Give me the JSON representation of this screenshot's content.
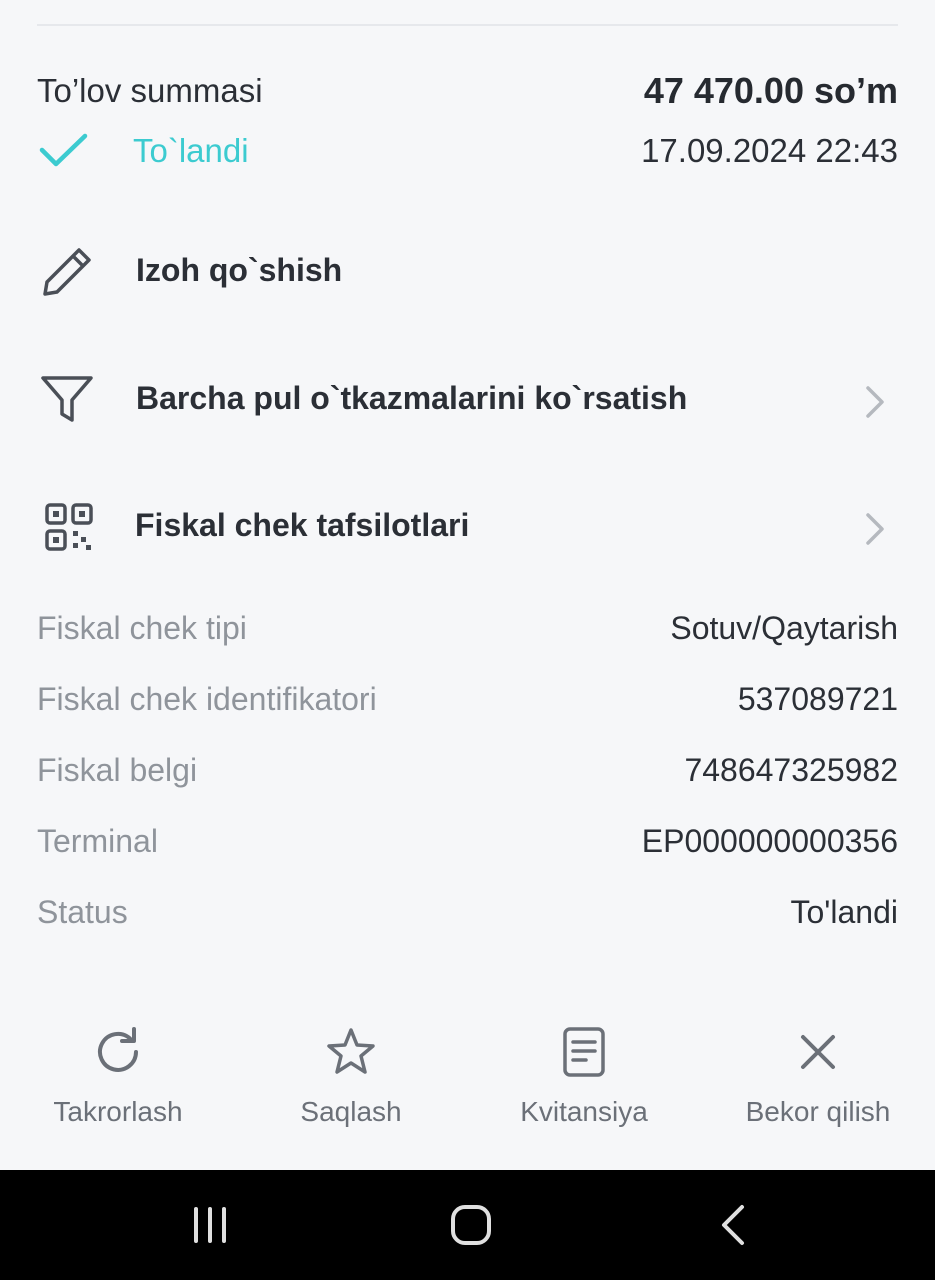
{
  "payment": {
    "amount_label": "To’lov summasi",
    "amount_value": "47 470.00 so’m",
    "status": "To`landi",
    "datetime": "17.09.2024 22:43"
  },
  "actions": {
    "comment": "Izoh qo`shish",
    "all_transfers": "Barcha pul o`tkazmalarini ko`rsatish",
    "fiscal_details": "Fiskal chek tafsilotlari"
  },
  "fiscal": [
    {
      "label": "Fiskal chek tipi",
      "value": "Sotuv/Qaytarish"
    },
    {
      "label": "Fiskal chek identifikatori",
      "value": "537089721"
    },
    {
      "label": "Fiskal belgi",
      "value": "748647325982"
    },
    {
      "label": "Terminal",
      "value": "EP000000000356"
    },
    {
      "label": "Status",
      "value": "To'landi"
    }
  ],
  "bottom_actions": {
    "repeat": "Takrorlash",
    "save": "Saqlash",
    "receipt": "Kvitansiya",
    "cancel": "Bekor qilish"
  },
  "colors": {
    "accent": "#3ccbd0",
    "background": "#f6f7f9",
    "text_primary": "#2b2f36",
    "text_secondary": "#8f949b",
    "nav_bar": "#000000"
  },
  "icons": {
    "status": "check-icon",
    "comment": "pencil-icon",
    "all_transfers": "filter-icon",
    "fiscal_details": "qr-code-icon",
    "repeat": "refresh-icon",
    "save": "star-icon",
    "receipt": "document-icon",
    "cancel": "close-icon"
  }
}
